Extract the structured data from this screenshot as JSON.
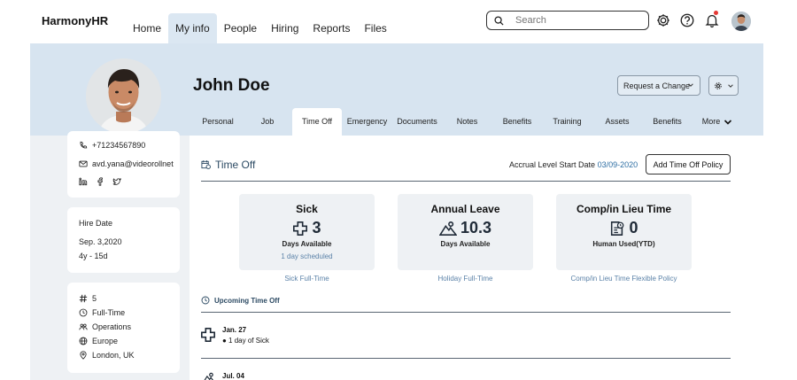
{
  "brand": "HarmonyHR",
  "nav": [
    {
      "label": "Home"
    },
    {
      "label": "My info",
      "active": true
    },
    {
      "label": "People"
    },
    {
      "label": "Hiring"
    },
    {
      "label": "Reports"
    },
    {
      "label": "Files"
    }
  ],
  "search": {
    "placeholder": "Search"
  },
  "icons": {
    "settings": "gear-icon",
    "help": "question-icon",
    "notifications": "bell-icon",
    "notification_dot_color": "#e53935"
  },
  "profile": {
    "name": "John Doe",
    "request_change_label": "Request a Change"
  },
  "tabs": [
    {
      "label": "Personal"
    },
    {
      "label": "Job"
    },
    {
      "label": "Time Off",
      "active": true
    },
    {
      "label": "Emergency"
    },
    {
      "label": "Documents"
    },
    {
      "label": "Notes"
    },
    {
      "label": "Benefits"
    },
    {
      "label": "Training"
    },
    {
      "label": "Assets"
    },
    {
      "label": "Benefits"
    },
    {
      "label": "More"
    }
  ],
  "contact": {
    "phone": "+71234567890",
    "email": "avd.yana@videorollnet"
  },
  "hire": {
    "label": "Hire Date",
    "date": "Sep. 3,2020",
    "tenure": "4y - 15d"
  },
  "info": {
    "id": "5",
    "employment": "Full-Time",
    "department": "Operations",
    "region": "Europe",
    "location": "London, UK"
  },
  "timeoff": {
    "title": "Time Off",
    "accrual_label": "Accrual Level Start Date",
    "accrual_date": "03/09-2020",
    "add_policy_label": "Add Time Off Policy",
    "cards": [
      {
        "title": "Sick",
        "value": "3",
        "sub": "Days Available",
        "scheduled": "1 day scheduled",
        "policy": "Sick Full-Time"
      },
      {
        "title": "Annual Leave",
        "value": "10.3",
        "sub": "Days Available",
        "scheduled": "",
        "policy": "Holiday Full-Time"
      },
      {
        "title": "Comp/in Lieu Time",
        "value": "0",
        "sub": "Human Used(YTD)",
        "scheduled": "",
        "policy": "Comp/in Lieu Time Flexible Policy"
      }
    ],
    "upcoming_label": "Upcoming Time Off",
    "events": [
      {
        "date": "Jan. 27",
        "desc": "● 1 day of Sick"
      },
      {
        "date": "Jul. 04",
        "desc": ""
      }
    ]
  }
}
